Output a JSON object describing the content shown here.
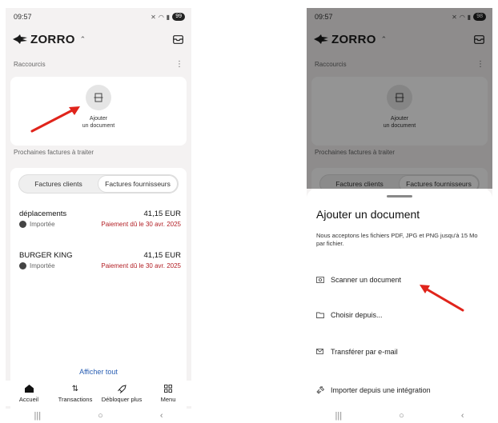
{
  "left": {
    "status": {
      "time": "09:57",
      "battery": "99"
    },
    "brand": "ZORRO",
    "shortcuts_label": "Raccourcis",
    "shortcut": {
      "line1": "Ajouter",
      "line2": "un document"
    },
    "upcoming_label": "Prochaines factures à traiter",
    "tabs": [
      "Factures clients",
      "Factures fournisseurs"
    ],
    "invoices": [
      {
        "name": "déplacements",
        "amount": "41,15 EUR",
        "status": "Importée",
        "due": "Paiement dû le 30 avr. 2025"
      },
      {
        "name": "BURGER KING",
        "amount": "41,15 EUR",
        "status": "Importée",
        "due": "Paiement dû le 30 avr. 2025"
      }
    ],
    "show_all": "Afficher tout",
    "nav": [
      {
        "label": "Accueil",
        "icon": "home-icon"
      },
      {
        "label": "Transactions",
        "icon": "transfer-arrows-icon"
      },
      {
        "label": "Débloquer plus",
        "icon": "rocket-icon"
      },
      {
        "label": "Menu",
        "icon": "grid-icon"
      }
    ]
  },
  "right": {
    "status": {
      "time": "09:57",
      "battery": "98"
    },
    "brand": "ZORRO",
    "shortcuts_label": "Raccourcis",
    "shortcut": {
      "line1": "Ajouter",
      "line2": "un document"
    },
    "upcoming_label": "Prochaines factures à traiter",
    "tabs": [
      "Factures clients",
      "Factures fournisseurs"
    ],
    "sheet": {
      "title": "Ajouter un document",
      "description": "Nous acceptons les fichiers PDF, JPG et PNG jusqu'à 15 Mo par fichier.",
      "options": [
        {
          "label": "Scanner un document",
          "icon": "scan-icon"
        },
        {
          "label": "Choisir depuis...",
          "icon": "folder-icon"
        },
        {
          "label": "Transférer par e-mail",
          "icon": "email-forward-icon"
        },
        {
          "label": "Importer depuis une intégration",
          "icon": "plugin-icon"
        }
      ]
    }
  },
  "colors": {
    "accent_red": "#e0241b",
    "due_red": "#b32127",
    "link_blue": "#2a5fb3"
  }
}
